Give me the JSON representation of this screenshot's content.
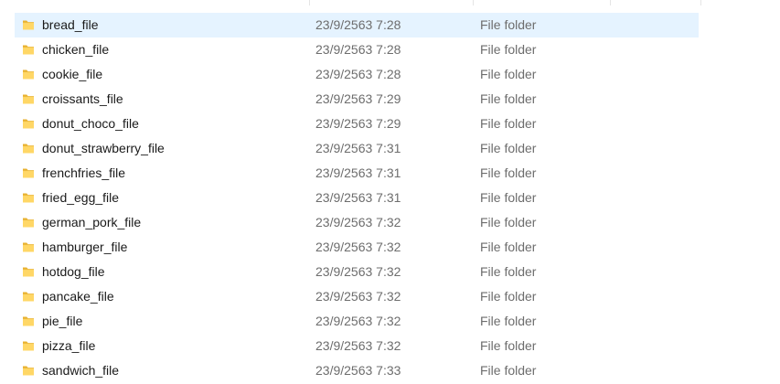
{
  "colors": {
    "selected_row": "#e5f3ff",
    "folder_icon": "#f5c542",
    "secondary_text": "#6d6d6d"
  },
  "files": [
    {
      "name": "bread_file",
      "date": "23/9/2563 7:28",
      "type": "File folder",
      "icon": "folder-icon",
      "selected": true
    },
    {
      "name": "chicken_file",
      "date": "23/9/2563 7:28",
      "type": "File folder",
      "icon": "folder-icon"
    },
    {
      "name": "cookie_file",
      "date": "23/9/2563 7:28",
      "type": "File folder",
      "icon": "folder-icon"
    },
    {
      "name": "croissants_file",
      "date": "23/9/2563 7:29",
      "type": "File folder",
      "icon": "folder-icon"
    },
    {
      "name": "donut_choco_file",
      "date": "23/9/2563 7:29",
      "type": "File folder",
      "icon": "folder-icon"
    },
    {
      "name": "donut_strawberry_file",
      "date": "23/9/2563 7:31",
      "type": "File folder",
      "icon": "folder-icon"
    },
    {
      "name": "frenchfries_file",
      "date": "23/9/2563 7:31",
      "type": "File folder",
      "icon": "folder-icon"
    },
    {
      "name": "fried_egg_file",
      "date": "23/9/2563 7:31",
      "type": "File folder",
      "icon": "folder-icon"
    },
    {
      "name": "german_pork_file",
      "date": "23/9/2563 7:32",
      "type": "File folder",
      "icon": "folder-icon"
    },
    {
      "name": "hamburger_file",
      "date": "23/9/2563 7:32",
      "type": "File folder",
      "icon": "folder-icon"
    },
    {
      "name": "hotdog_file",
      "date": "23/9/2563 7:32",
      "type": "File folder",
      "icon": "folder-icon"
    },
    {
      "name": "pancake_file",
      "date": "23/9/2563 7:32",
      "type": "File folder",
      "icon": "folder-icon"
    },
    {
      "name": "pie_file",
      "date": "23/9/2563 7:32",
      "type": "File folder",
      "icon": "folder-icon"
    },
    {
      "name": "pizza_file",
      "date": "23/9/2563 7:32",
      "type": "File folder",
      "icon": "folder-icon"
    },
    {
      "name": "sandwich_file",
      "date": "23/9/2563 7:33",
      "type": "File folder",
      "icon": "folder-icon"
    }
  ]
}
